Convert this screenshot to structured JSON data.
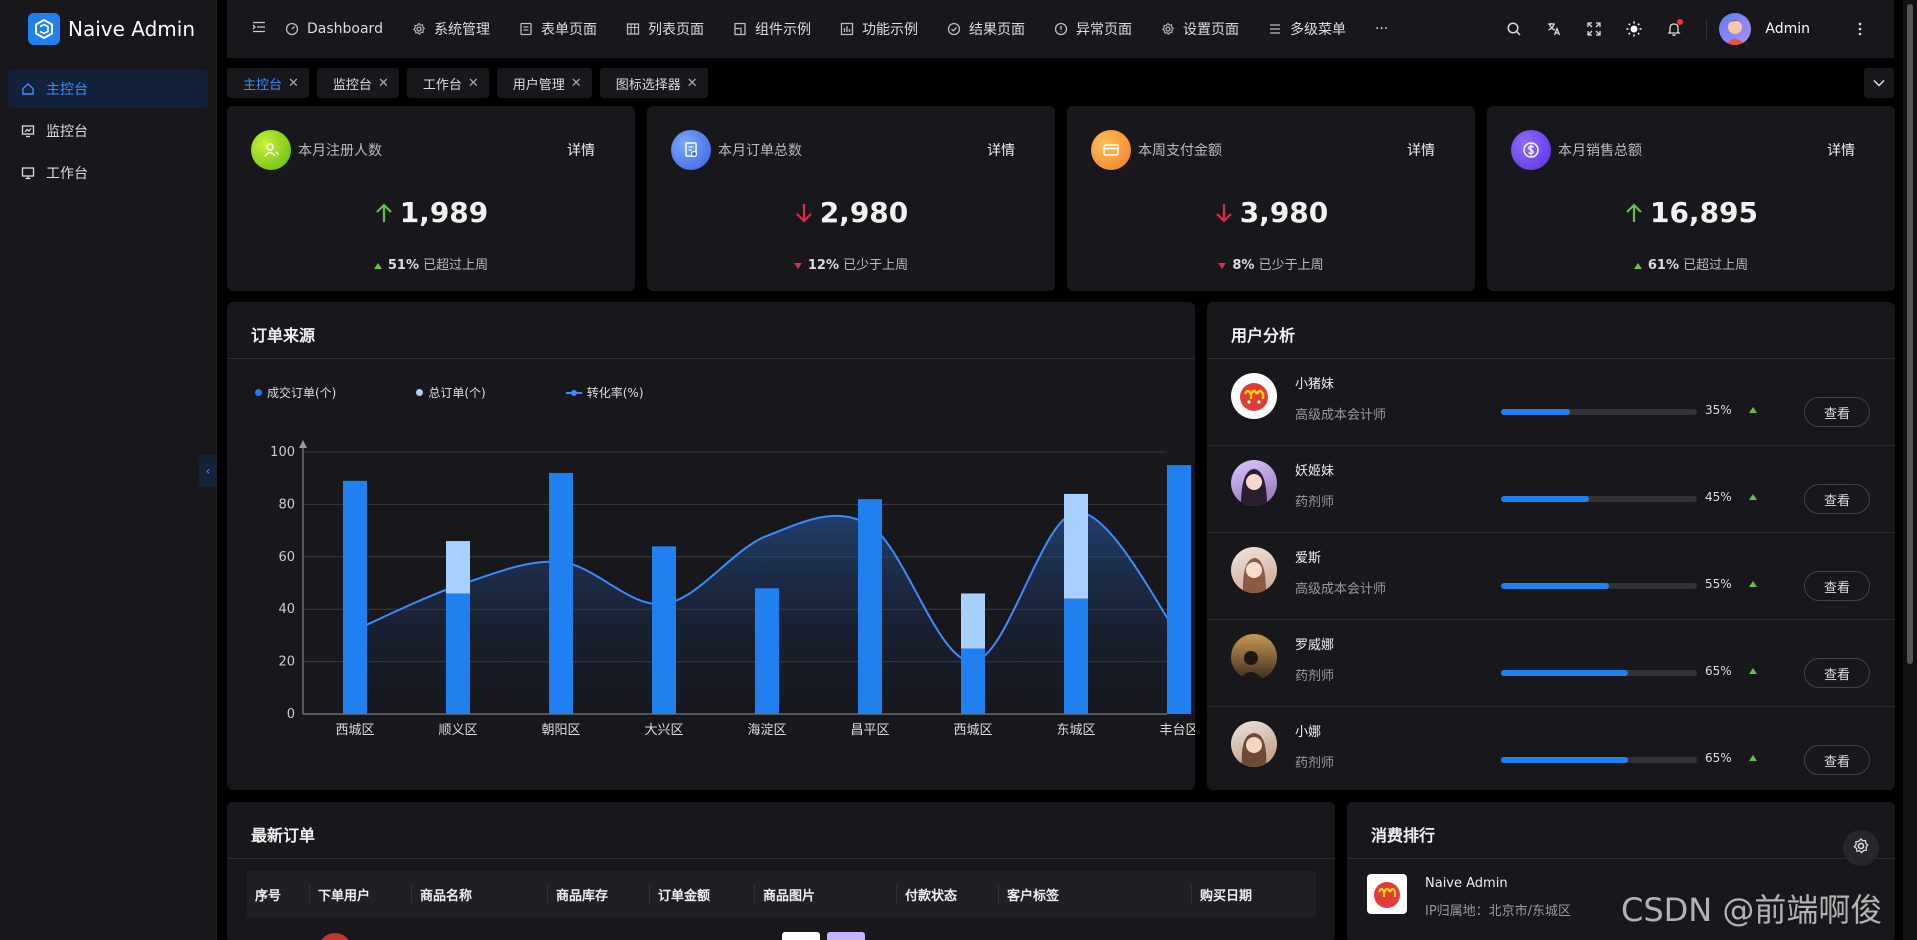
{
  "app": {
    "title": "Naive Admin"
  },
  "sidebar": {
    "items": [
      {
        "label": "主控台",
        "icon": "home-icon",
        "active": true
      },
      {
        "label": "监控台",
        "icon": "monitor-chart-icon",
        "active": false
      },
      {
        "label": "工作台",
        "icon": "desktop-icon",
        "active": false
      }
    ]
  },
  "topnav": {
    "items": [
      {
        "label": "Dashboard",
        "icon": "dashboard-icon"
      },
      {
        "label": "系统管理",
        "icon": "gear-icon"
      },
      {
        "label": "表单页面",
        "icon": "form-icon"
      },
      {
        "label": "列表页面",
        "icon": "table-icon"
      },
      {
        "label": "组件示例",
        "icon": "component-icon"
      },
      {
        "label": "功能示例",
        "icon": "feature-icon"
      },
      {
        "label": "结果页面",
        "icon": "check-circle-icon"
      },
      {
        "label": "异常页面",
        "icon": "alert-circle-icon"
      },
      {
        "label": "设置页面",
        "icon": "settings-icon"
      },
      {
        "label": "多级菜单",
        "icon": "menu-icon"
      }
    ],
    "more": "···"
  },
  "user": {
    "name": "Admin"
  },
  "tabs": [
    {
      "label": "主控台",
      "active": true
    },
    {
      "label": "监控台",
      "active": false
    },
    {
      "label": "工作台",
      "active": false
    },
    {
      "label": "用户管理",
      "active": false
    },
    {
      "label": "图标选择器",
      "active": false
    }
  ],
  "stats": [
    {
      "title": "本月注册人数",
      "detail": "详情",
      "value": "1,989",
      "trend": "up",
      "pct": "51%",
      "compare": "已超过上周",
      "icon_color": "#7ed321",
      "icon": "user-plus-icon"
    },
    {
      "title": "本月订单总数",
      "detail": "详情",
      "value": "2,980",
      "trend": "down",
      "pct": "12%",
      "compare": "已少于上周",
      "icon_color": "#4f7ff0",
      "icon": "document-icon"
    },
    {
      "title": "本周支付金额",
      "detail": "详情",
      "value": "3,980",
      "trend": "down",
      "pct": "8%",
      "compare": "已少于上周",
      "icon_color": "#f5a030",
      "icon": "card-icon"
    },
    {
      "title": "本月销售总额",
      "detail": "详情",
      "value": "16,895",
      "trend": "up",
      "pct": "61%",
      "compare": "已超过上周",
      "icon_color": "#6a4ff0",
      "icon": "dollar-icon"
    }
  ],
  "orders_panel": {
    "title": "订单来源"
  },
  "chart_data": {
    "type": "bar",
    "categories": [
      "西城区",
      "顺义区",
      "朝阳区",
      "大兴区",
      "海淀区",
      "昌平区",
      "西城区",
      "东城区",
      "丰台区"
    ],
    "series": [
      {
        "name": "成交订单(个)",
        "type": "bar",
        "color": "#2080f0",
        "values": [
          89,
          46,
          92,
          64,
          48,
          82,
          25,
          44,
          95
        ]
      },
      {
        "name": "总订单(个)",
        "type": "bar",
        "color": "#a8d0ff",
        "values": [
          89,
          66,
          92,
          64,
          48,
          82,
          46,
          84,
          95
        ]
      },
      {
        "name": "转化率(%)",
        "type": "area",
        "color": "#3b8bff",
        "values": [
          32,
          49,
          58,
          42,
          68,
          72,
          20,
          77,
          30
        ]
      }
    ],
    "yticks": [
      0,
      20,
      40,
      60,
      80,
      100
    ],
    "ylim": [
      0,
      100
    ],
    "legend": "top-left"
  },
  "users_panel": {
    "title": "用户分析",
    "button_label": "查看",
    "rows": [
      {
        "name": "小猪妹",
        "role": "高级成本会计师",
        "pct": "35%",
        "value": 0.35
      },
      {
        "name": "妖姬妹",
        "role": "药剂师",
        "pct": "45%",
        "value": 0.45
      },
      {
        "name": "爱斯",
        "role": "高级成本会计师",
        "pct": "55%",
        "value": 0.55
      },
      {
        "name": "罗威娜",
        "role": "药剂师",
        "pct": "65%",
        "value": 0.65
      },
      {
        "name": "小娜",
        "role": "药剂师",
        "pct": "65%",
        "value": 0.65
      }
    ]
  },
  "latest_orders": {
    "title": "最新订单",
    "columns": [
      "序号",
      "下单用户",
      "商品名称",
      "商品库存",
      "订单金额",
      "商品图片",
      "付款状态",
      "客户标签",
      "购买日期"
    ]
  },
  "ranking": {
    "title": "消费排行",
    "top": {
      "name": "Naive Admin",
      "ip": "IP归属地：北京市/东城区"
    }
  },
  "watermark": "CSDN @前端啊俊"
}
